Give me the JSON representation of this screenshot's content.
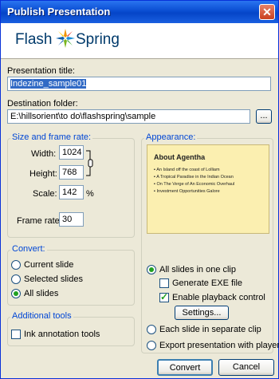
{
  "window": {
    "title": "Publish Presentation",
    "close_glyph": "✕"
  },
  "logo": {
    "part1": "Flash",
    "part2": "Spring"
  },
  "presentation_title": {
    "label": "Presentation title:",
    "value": "Indezine_sample01"
  },
  "destination": {
    "label": "Destination folder:",
    "value": "E:\\hillsorient\\to do\\flashspring\\sample",
    "browse_label": "..."
  },
  "size": {
    "group_title": "Size and frame rate:",
    "width_label": "Width:",
    "width_value": "1024",
    "height_label": "Height:",
    "height_value": "768",
    "scale_label": "Scale:",
    "scale_value": "142",
    "scale_unit": "%",
    "frame_rate_label": "Frame rate:",
    "frame_rate_value": "30"
  },
  "convert": {
    "group_title": "Convert:",
    "options": [
      "Current slide",
      "Selected slides",
      "All slides"
    ],
    "selected_index": 2
  },
  "additional": {
    "group_title": "Additional tools",
    "ink_label": "Ink annotation tools",
    "ink_checked": false
  },
  "appearance": {
    "group_title": "Appearance:",
    "preview_title": "About Agentha",
    "preview_bullets": [
      "An Island off the coast of Lolliam",
      "A Tropical Paradise in the Indian Ocean",
      "On The Verge of An Economic Overhaul",
      "Investment Opportunities Galore"
    ],
    "all_in_one_label": "All slides in one clip",
    "all_in_one_selected": true,
    "generate_exe_label": "Generate EXE file",
    "generate_exe_checked": false,
    "playback_label": "Enable playback control",
    "playback_checked": true,
    "settings_label": "Settings...",
    "separate_label": "Each slide in separate clip",
    "export_player_label": "Export presentation with player"
  },
  "buttons": {
    "convert": "Convert",
    "cancel": "Cancel"
  },
  "colors": {
    "title_bar": "#0a4ed2",
    "group_title": "#0046d5",
    "preview_bg": "#fbefb0",
    "selection": "#316ac5"
  },
  "icons": {
    "close": "close-icon",
    "link": "chain-link-icon",
    "logo": "flashspring-logo-icon"
  }
}
